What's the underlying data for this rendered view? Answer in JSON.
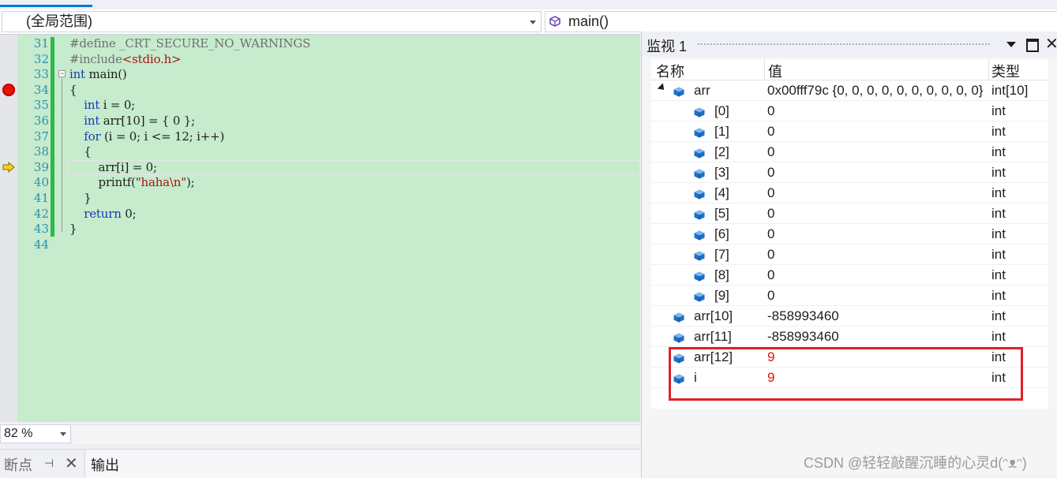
{
  "navbar": {
    "scope": "(全局范围)",
    "function": "main()"
  },
  "editor": {
    "lines": [
      {
        "num": "31",
        "segments": [
          {
            "t": "#define _CRT_SECURE_NO_WARNINGS",
            "c": "pp"
          }
        ]
      },
      {
        "num": "32",
        "segments": [
          {
            "t": "#include",
            "c": "pp"
          },
          {
            "t": "<stdio.h>",
            "c": "str"
          }
        ]
      },
      {
        "num": "33",
        "segments": [
          {
            "t": "int",
            "c": "kw"
          },
          {
            "t": " main()",
            "c": ""
          }
        ]
      },
      {
        "num": "34",
        "segments": [
          {
            "t": "{",
            "c": ""
          }
        ]
      },
      {
        "num": "35",
        "segments": [
          {
            "t": "    ",
            "c": ""
          },
          {
            "t": "int",
            "c": "kw"
          },
          {
            "t": " i = 0;",
            "c": ""
          }
        ]
      },
      {
        "num": "36",
        "segments": [
          {
            "t": "    ",
            "c": ""
          },
          {
            "t": "int",
            "c": "kw"
          },
          {
            "t": " arr[10] = { 0 };",
            "c": ""
          }
        ]
      },
      {
        "num": "37",
        "segments": [
          {
            "t": "    ",
            "c": ""
          },
          {
            "t": "for",
            "c": "kw"
          },
          {
            "t": " (i = 0; i <= 12; i++)",
            "c": ""
          }
        ]
      },
      {
        "num": "38",
        "segments": [
          {
            "t": "    {",
            "c": ""
          }
        ]
      },
      {
        "num": "39",
        "segments": [
          {
            "t": "        arr[i] = 0;",
            "c": ""
          }
        ]
      },
      {
        "num": "40",
        "segments": [
          {
            "t": "        printf(",
            "c": ""
          },
          {
            "t": "\"haha\\n\"",
            "c": "str"
          },
          {
            "t": ");",
            "c": ""
          }
        ]
      },
      {
        "num": "41",
        "segments": [
          {
            "t": "    }",
            "c": ""
          }
        ]
      },
      {
        "num": "42",
        "segments": [
          {
            "t": "    ",
            "c": ""
          },
          {
            "t": "return",
            "c": "kw"
          },
          {
            "t": " 0;",
            "c": ""
          }
        ]
      },
      {
        "num": "43",
        "segments": [
          {
            "t": "}",
            "c": ""
          }
        ]
      },
      {
        "num": "44",
        "segments": []
      }
    ]
  },
  "zoom": "82 %",
  "bottom_tabs": {
    "breakpoints": "断点",
    "output": "输出"
  },
  "watch": {
    "title": "监视 1",
    "columns": {
      "name": "名称",
      "value": "值",
      "type": "类型"
    },
    "rows": [
      {
        "name": "arr",
        "value": "0x00fff79c {0, 0, 0, 0, 0, 0, 0, 0, 0, 0}",
        "type": "int[10]",
        "level": 0,
        "expanded": true,
        "changed": false
      },
      {
        "name": "[0]",
        "value": "0",
        "type": "int",
        "level": 1,
        "changed": false
      },
      {
        "name": "[1]",
        "value": "0",
        "type": "int",
        "level": 1,
        "changed": false
      },
      {
        "name": "[2]",
        "value": "0",
        "type": "int",
        "level": 1,
        "changed": false
      },
      {
        "name": "[3]",
        "value": "0",
        "type": "int",
        "level": 1,
        "changed": false
      },
      {
        "name": "[4]",
        "value": "0",
        "type": "int",
        "level": 1,
        "changed": false
      },
      {
        "name": "[5]",
        "value": "0",
        "type": "int",
        "level": 1,
        "changed": false
      },
      {
        "name": "[6]",
        "value": "0",
        "type": "int",
        "level": 1,
        "changed": false
      },
      {
        "name": "[7]",
        "value": "0",
        "type": "int",
        "level": 1,
        "changed": false
      },
      {
        "name": "[8]",
        "value": "0",
        "type": "int",
        "level": 1,
        "changed": false
      },
      {
        "name": "[9]",
        "value": "0",
        "type": "int",
        "level": 1,
        "changed": false
      },
      {
        "name": "arr[10]",
        "value": "-858993460",
        "type": "int",
        "level": 0,
        "changed": false
      },
      {
        "name": "arr[11]",
        "value": "-858993460",
        "type": "int",
        "level": 0,
        "changed": false
      },
      {
        "name": "arr[12]",
        "value": "9",
        "type": "int",
        "level": 0,
        "changed": true
      },
      {
        "name": "i",
        "value": "9",
        "type": "int",
        "level": 0,
        "changed": true
      }
    ]
  },
  "watermark": "CSDN @轻轻敲醒沉睡的心灵d(ᵔᴥᵔ)",
  "colors": {
    "editor_bg": "#c6ebcd",
    "keyword": "#1a39b7",
    "string": "#a31515",
    "changed_value": "#e51400",
    "highlight_box": "#e0202a",
    "tab_accent": "#007acc"
  }
}
